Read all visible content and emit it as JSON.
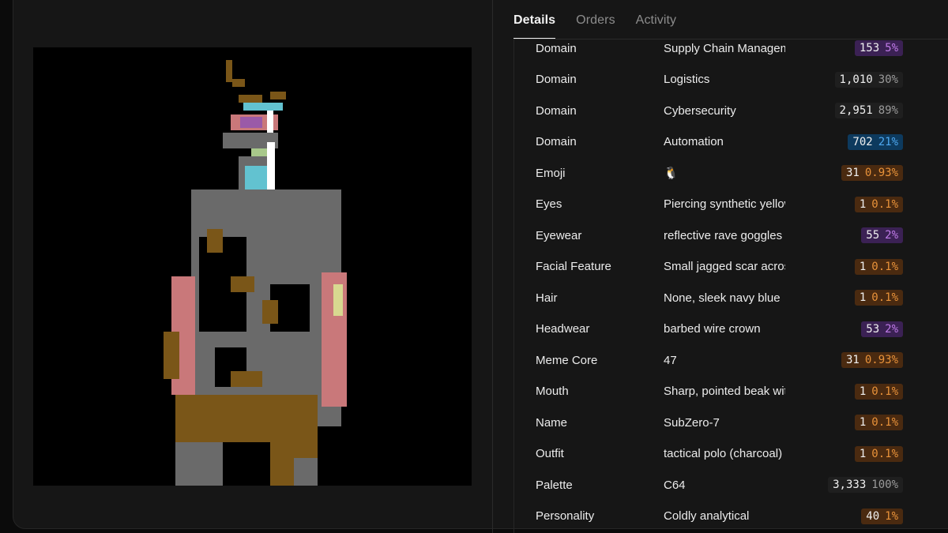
{
  "tabs": [
    {
      "label": "Details",
      "active": true
    },
    {
      "label": "Orders",
      "active": false
    },
    {
      "label": "Activity",
      "active": false
    }
  ],
  "traits": [
    {
      "name": "Domain",
      "value": "Supply Chain Management",
      "count": "153",
      "percent": "5%",
      "color": "purple"
    },
    {
      "name": "Domain",
      "value": "Logistics",
      "count": "1,010",
      "percent": "30%",
      "color": "gray"
    },
    {
      "name": "Domain",
      "value": "Cybersecurity",
      "count": "2,951",
      "percent": "89%",
      "color": "gray"
    },
    {
      "name": "Domain",
      "value": "Automation",
      "count": "702",
      "percent": "21%",
      "color": "blue"
    },
    {
      "name": "Emoji",
      "value": "🐧",
      "count": "31",
      "percent": "0.93%",
      "color": "orange"
    },
    {
      "name": "Eyes",
      "value": "Piercing synthetic yellow",
      "count": "1",
      "percent": "0.1%",
      "color": "orange"
    },
    {
      "name": "Eyewear",
      "value": "reflective rave goggles",
      "count": "55",
      "percent": "2%",
      "color": "purple"
    },
    {
      "name": "Facial Feature",
      "value": "Small jagged scar across",
      "count": "1",
      "percent": "0.1%",
      "color": "orange"
    },
    {
      "name": "Hair",
      "value": "None, sleek navy blue",
      "count": "1",
      "percent": "0.1%",
      "color": "orange"
    },
    {
      "name": "Headwear",
      "value": "barbed wire crown",
      "count": "53",
      "percent": "2%",
      "color": "purple"
    },
    {
      "name": "Meme Core",
      "value": "47",
      "count": "31",
      "percent": "0.93%",
      "color": "orange"
    },
    {
      "name": "Mouth",
      "value": "Sharp, pointed beak with",
      "count": "1",
      "percent": "0.1%",
      "color": "orange"
    },
    {
      "name": "Name",
      "value": "SubZero-7",
      "count": "1",
      "percent": "0.1%",
      "color": "orange"
    },
    {
      "name": "Outfit",
      "value": "tactical polo (charcoal)",
      "count": "1",
      "percent": "0.1%",
      "color": "orange"
    },
    {
      "name": "Palette",
      "value": "C64",
      "count": "3,333",
      "percent": "100%",
      "color": "gray"
    },
    {
      "name": "Personality",
      "value": "Coldly analytical",
      "count": "40",
      "percent": "1%",
      "color": "orange"
    }
  ]
}
